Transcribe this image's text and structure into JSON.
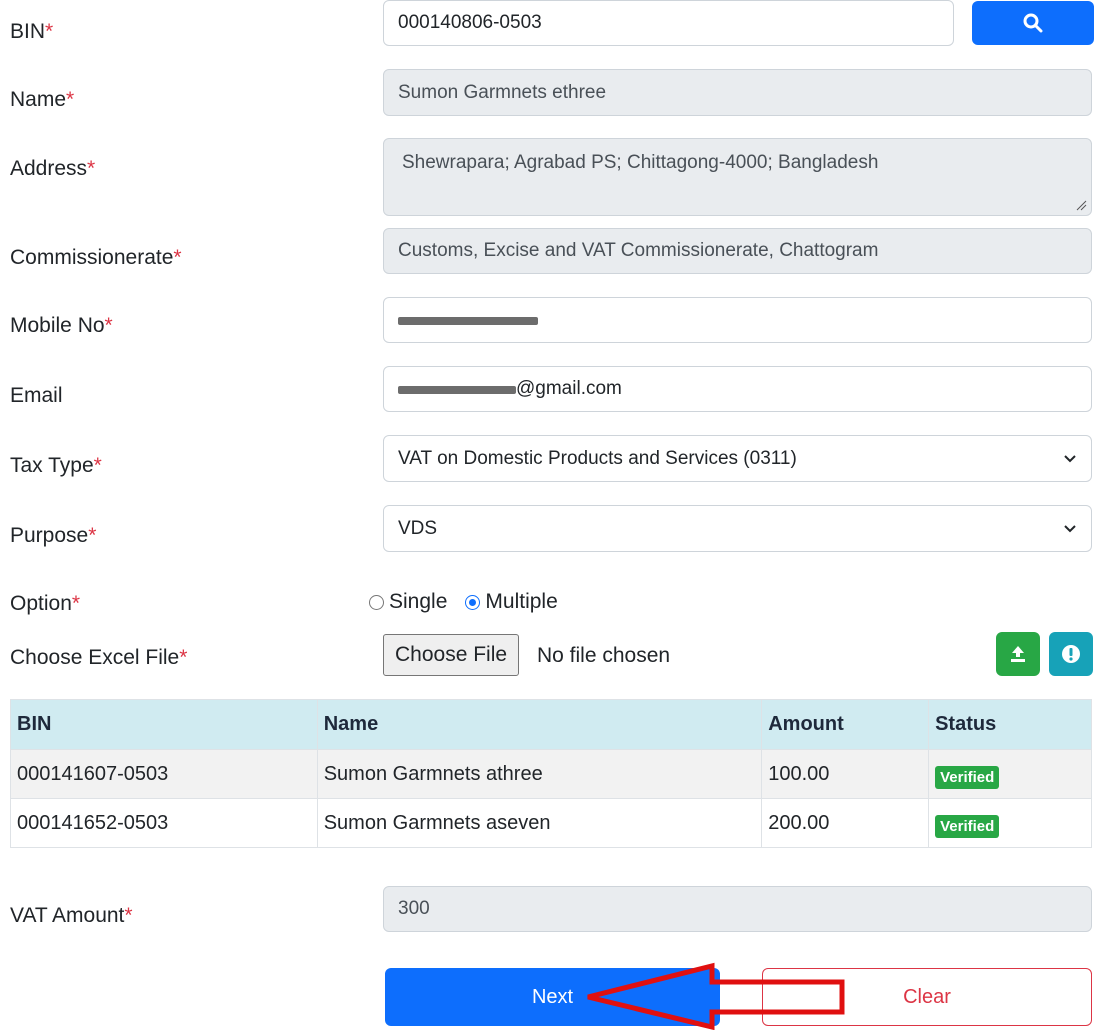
{
  "form": {
    "bin": {
      "label": "BIN",
      "value": "000140806-0503"
    },
    "name": {
      "label": "Name",
      "value": "Sumon Garmnets ethree"
    },
    "address": {
      "label": "Address",
      "value": "Shewrapara; Agrabad PS; Chittagong-4000; Bangladesh"
    },
    "commissionerate": {
      "label": "Commissionerate",
      "value": "Customs, Excise and VAT Commissionerate, Chattogram"
    },
    "mobile": {
      "label": "Mobile No"
    },
    "email": {
      "label": "Email",
      "visible_suffix": "@gmail.com"
    },
    "tax_type": {
      "label": "Tax Type",
      "value": "VAT on Domestic Products and Services (0311)"
    },
    "purpose": {
      "label": "Purpose",
      "value": "VDS"
    },
    "option": {
      "label": "Option",
      "choices": [
        "Single",
        "Multiple"
      ],
      "selected": "Multiple"
    },
    "excel": {
      "label": "Choose Excel File",
      "button": "Choose File",
      "status": "No file chosen"
    },
    "vat_amount": {
      "label": "VAT Amount",
      "value": "300"
    },
    "required_mark": "*"
  },
  "table": {
    "headers": [
      "BIN",
      "Name",
      "Amount",
      "Status"
    ],
    "rows": [
      {
        "bin": "000141607-0503",
        "name": "Sumon Garmnets athree",
        "amount": "100.00",
        "status": "Verified"
      },
      {
        "bin": "000141652-0503",
        "name": "Sumon Garmnets aseven",
        "amount": "200.00",
        "status": "Verified"
      }
    ]
  },
  "actions": {
    "next": "Next",
    "clear": "Clear"
  },
  "icons": {
    "search": "search-icon",
    "upload": "upload-icon",
    "info": "info-icon",
    "chevron": "chevron-down-icon"
  },
  "colors": {
    "primary": "#0d6efd",
    "danger": "#dc3545",
    "success": "#28a745",
    "info": "#17a2b8",
    "table_header": "#d0ebf1",
    "readonly_bg": "#e9ecef"
  }
}
